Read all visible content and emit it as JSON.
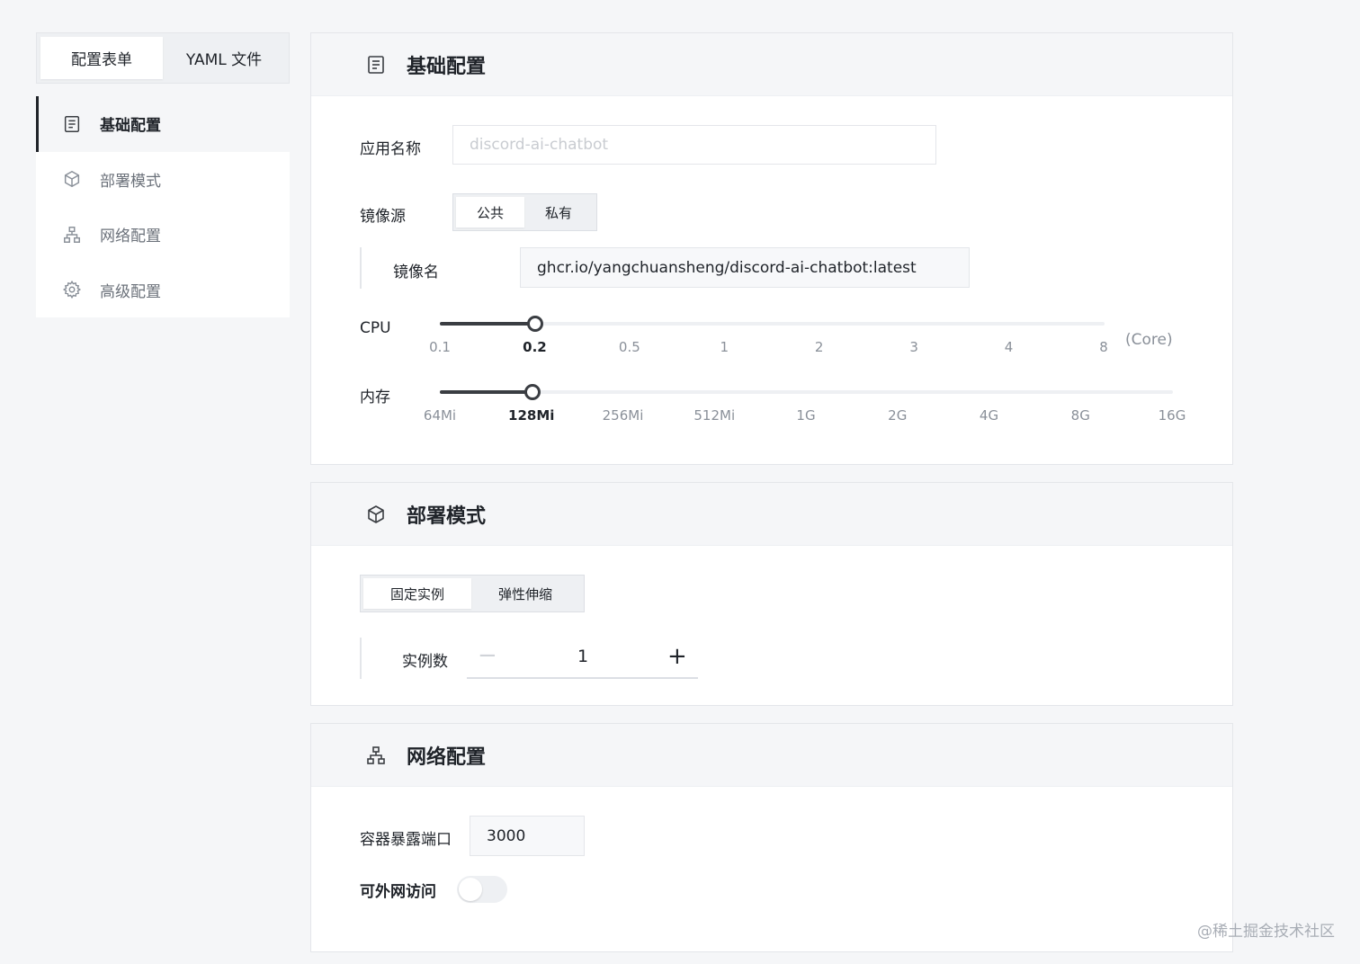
{
  "mode_tabs": [
    {
      "label": "配置表单",
      "active": true
    },
    {
      "label": "YAML 文件",
      "active": false
    }
  ],
  "nav": [
    {
      "label": "基础配置",
      "icon": "document-icon",
      "active": true
    },
    {
      "label": "部署模式",
      "icon": "cube-icon",
      "active": false
    },
    {
      "label": "网络配置",
      "icon": "network-icon",
      "active": false
    },
    {
      "label": "高级配置",
      "icon": "gear-icon",
      "active": false
    }
  ],
  "basic": {
    "title": "基础配置",
    "app_name_label": "应用名称",
    "app_name_placeholder": "discord-ai-chatbot",
    "image_source_label": "镜像源",
    "image_source_options": [
      "公共",
      "私有"
    ],
    "image_source_selected": "公共",
    "image_name_label": "镜像名",
    "image_name_value": "ghcr.io/yangchuansheng/discord-ai-chatbot:latest",
    "cpu_label": "CPU",
    "cpu_ticks": [
      "0.1",
      "0.2",
      "0.5",
      "1",
      "2",
      "3",
      "4",
      "8"
    ],
    "cpu_selected": "0.2",
    "cpu_unit": "(Core)",
    "memory_label": "内存",
    "memory_ticks": [
      "64Mi",
      "128Mi",
      "256Mi",
      "512Mi",
      "1G",
      "2G",
      "4G",
      "8G",
      "16G"
    ],
    "memory_selected": "128Mi"
  },
  "deploy": {
    "title": "部署模式",
    "mode_options": [
      "固定实例",
      "弹性伸缩"
    ],
    "mode_selected": "固定实例",
    "instances_label": "实例数",
    "instances_value": "1",
    "minus_symbol": "−",
    "plus_symbol": "+"
  },
  "network": {
    "title": "网络配置",
    "port_label": "容器暴露端口",
    "port_value": "3000",
    "public_access_label": "可外网访问",
    "public_access_enabled": false
  },
  "watermark": "@稀土掘金技术社区",
  "colors": {
    "accent": "#3a3d42",
    "background": "#f5f6f8"
  }
}
